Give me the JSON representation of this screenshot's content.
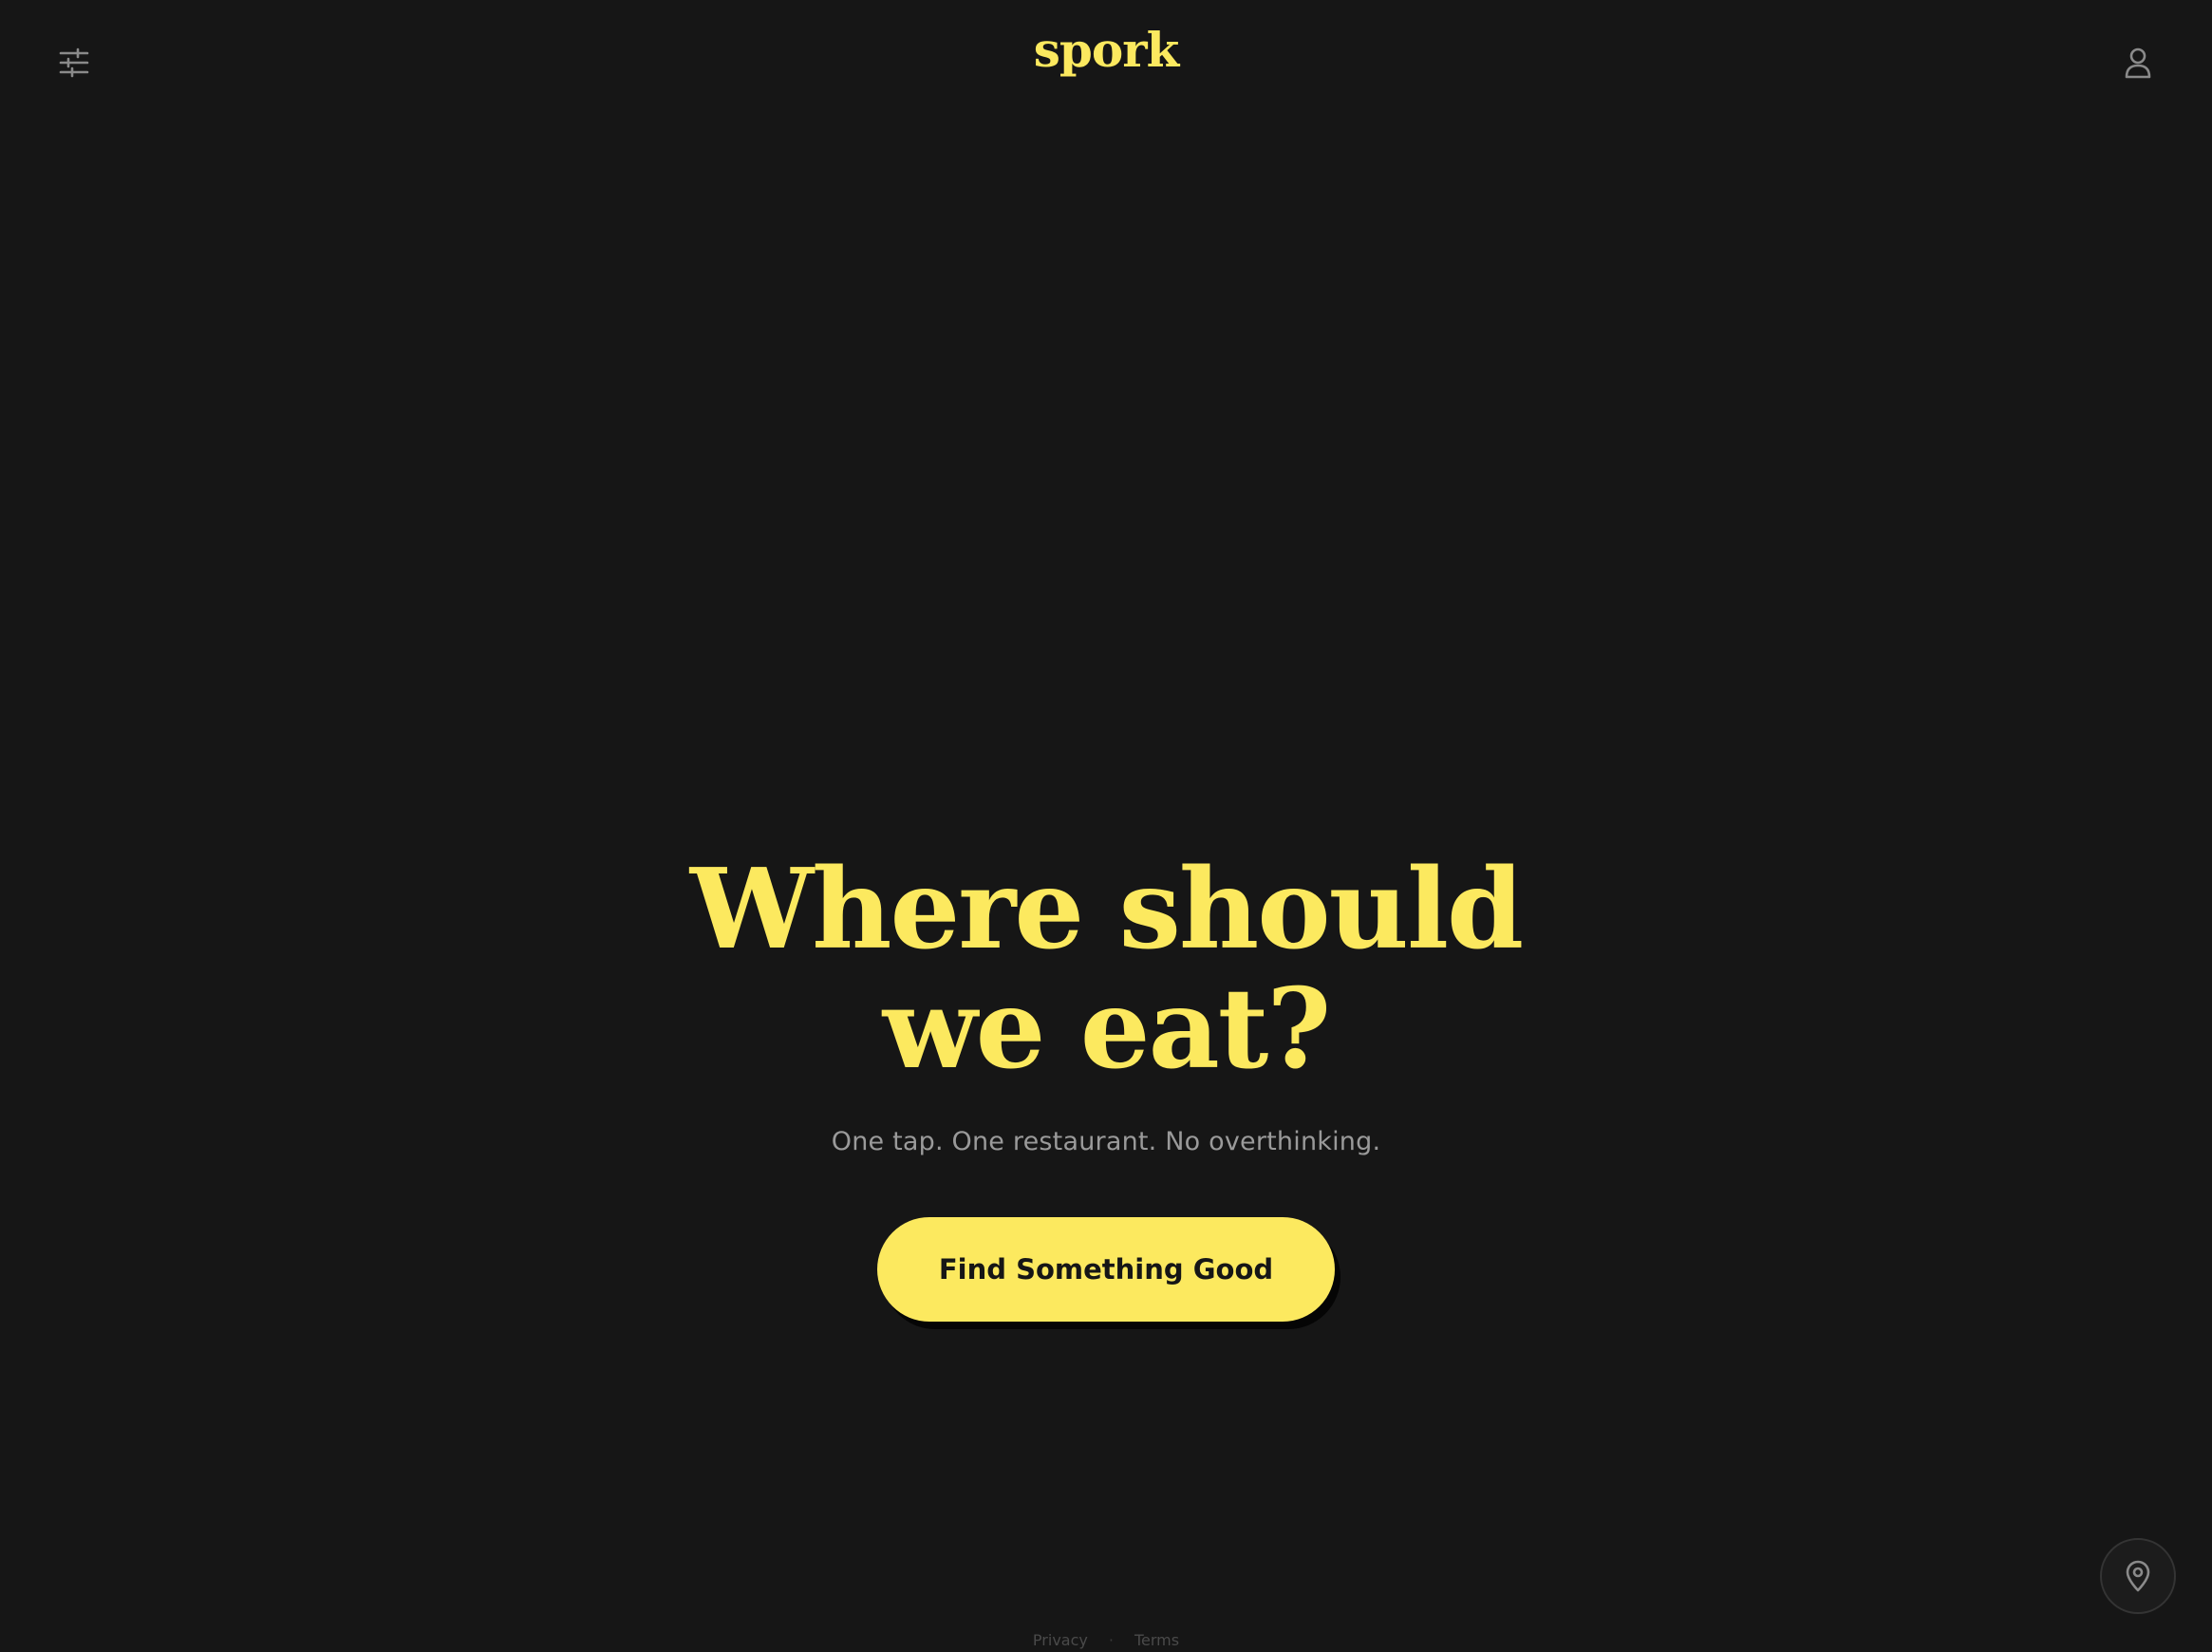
{
  "header": {
    "logo": "spork",
    "filters_icon": "sliders-icon",
    "profile_icon": "user-icon"
  },
  "hero": {
    "headline_line1": "Where should",
    "headline_line2": "we eat?",
    "subtitle": "One tap. One restaurant. No overthinking.",
    "cta_label": "Find Something Good"
  },
  "footer": {
    "privacy": "Privacy",
    "separator": "·",
    "terms": "Terms"
  },
  "location_button": {
    "icon": "map-pin-icon"
  },
  "colors": {
    "background": "#161616",
    "accent": "#fce95f",
    "muted_text": "#9a9a9a",
    "icon_gray": "#8a8a8a"
  }
}
